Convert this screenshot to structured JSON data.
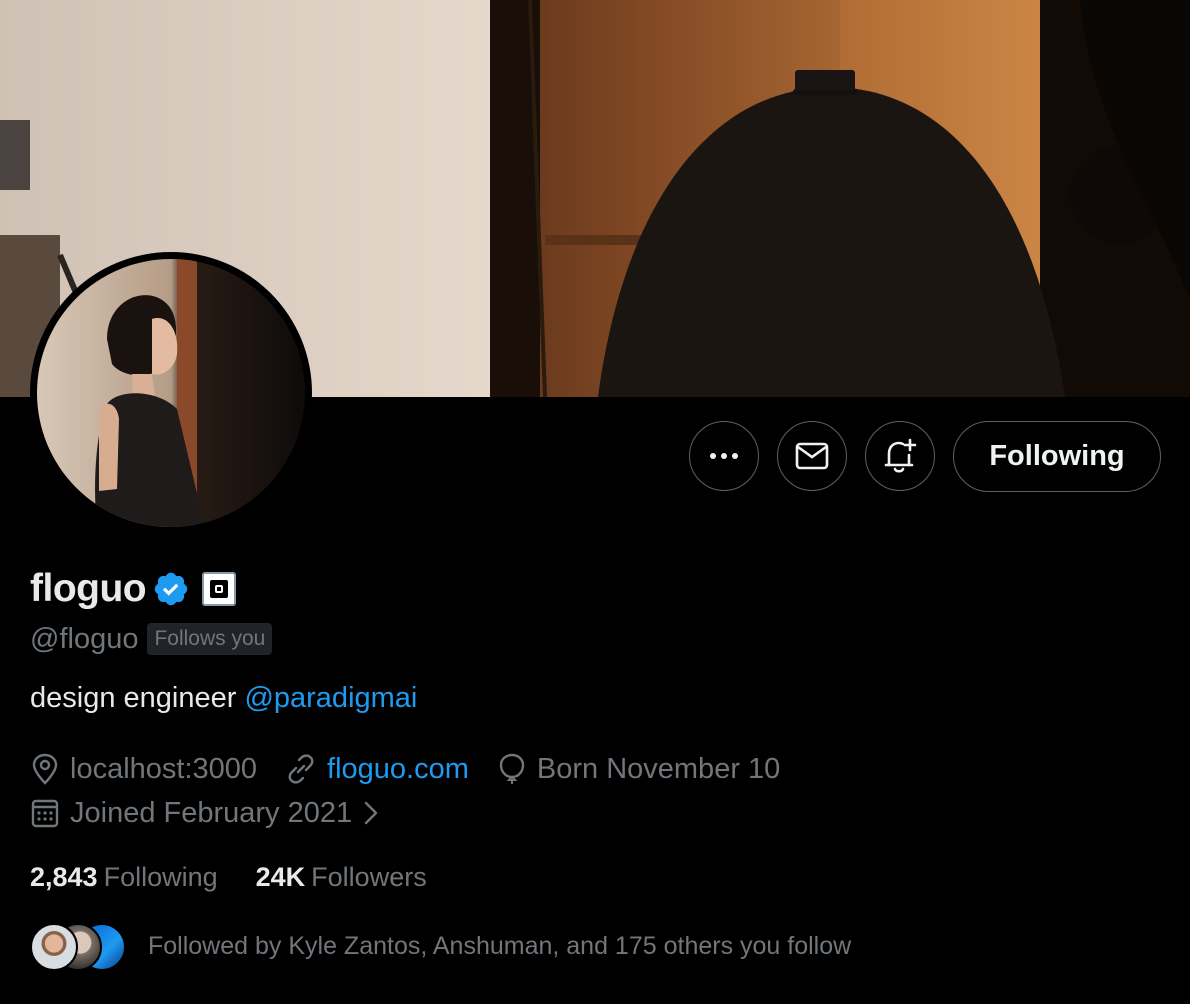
{
  "profile": {
    "display_name": "floguo",
    "handle": "@floguo",
    "follows_you_label": "Follows you",
    "bio_text": "design engineer ",
    "bio_mention": "@paradigmai",
    "location": "localhost:3000",
    "website": "floguo.com",
    "birthday": "Born November 10",
    "joined": "Joined February 2021"
  },
  "actions": {
    "following_label": "Following"
  },
  "stats": {
    "following_count": "2,843",
    "following_label": "Following",
    "followers_count": "24K",
    "followers_label": "Followers"
  },
  "followed_by": {
    "text": "Followed by Kyle Zantos, Anshuman, and 175 others you follow"
  },
  "icons": {
    "more": "more-icon",
    "message": "envelope-icon",
    "notify": "bell-plus-icon",
    "verified": "verified-badge-icon",
    "affiliation": "affiliation-badge-icon",
    "location": "location-pin-icon",
    "link": "link-icon",
    "birthday": "balloon-icon",
    "calendar": "calendar-icon",
    "chevron": "chevron-right-icon"
  },
  "colors": {
    "background": "#000000",
    "accent": "#1d9bf0",
    "primary_text": "#e7e9ea",
    "secondary_text": "#71767b",
    "border": "#536471"
  }
}
